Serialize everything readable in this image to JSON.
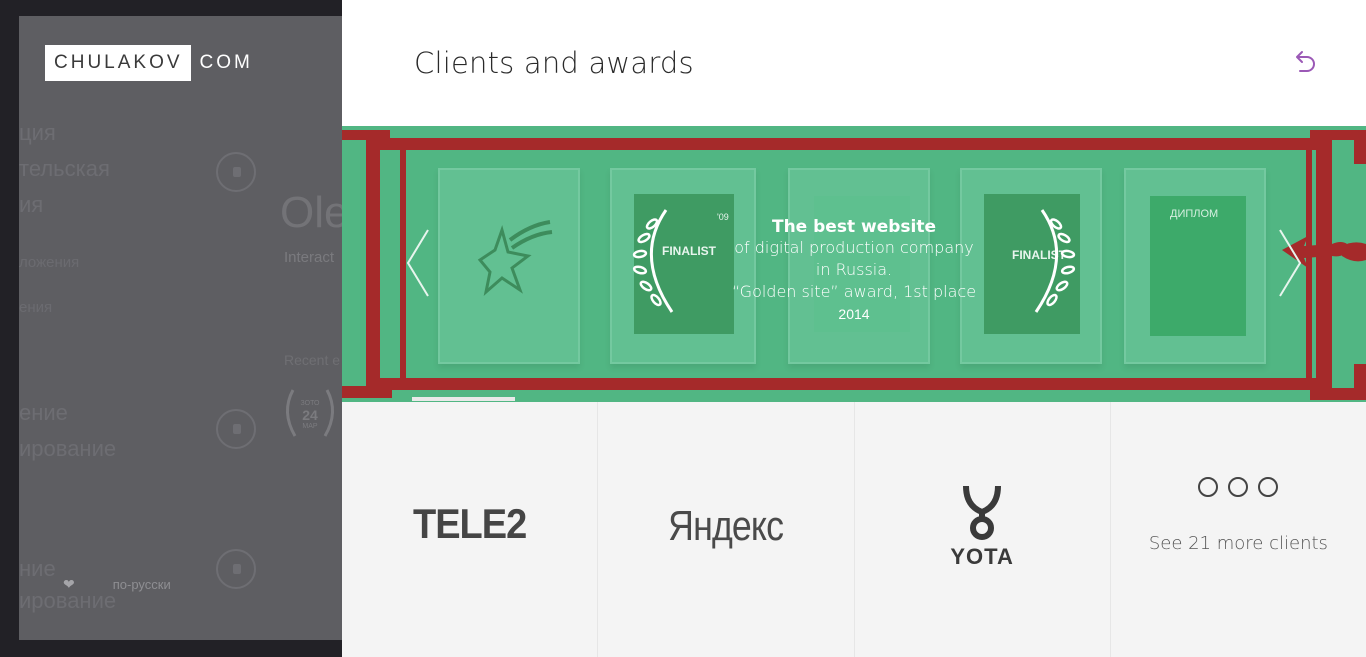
{
  "logo": {
    "box": "CHULAKOV",
    "suffix": "COM"
  },
  "background_page": {
    "peek_items": [
      "ция",
      "тельская",
      "ия",
      "ложения",
      "ения",
      "ение",
      "ирование",
      "ние",
      "ирование"
    ],
    "title_fragment": "Ole",
    "subtitle_fragment": "Interact",
    "recent_label": "Recent e",
    "badge": {
      "top": "ЗОТО",
      "day": "24",
      "month": "МАР"
    },
    "language_link": "по-русски"
  },
  "panel": {
    "title": "Clients and awards",
    "back_icon": "undo-arrow-icon",
    "accent_color": "#9b59b6"
  },
  "carousel": {
    "highlight_color": "#51b683",
    "border_color": "#a52a2a",
    "caption": {
      "heading": "The best website",
      "line1": "of digital production company",
      "line2": "in Russia.",
      "line3": "“Golden site” award, 1st place",
      "year": "2014"
    },
    "slide_texts": [
      "FINALIST",
      "'09",
      "ДИПЛОМ"
    ]
  },
  "clients": {
    "items": [
      {
        "name": "TELE2"
      },
      {
        "name": "Яндекс"
      },
      {
        "name": "YOTA"
      }
    ],
    "more_label": "See 21 more clients"
  }
}
